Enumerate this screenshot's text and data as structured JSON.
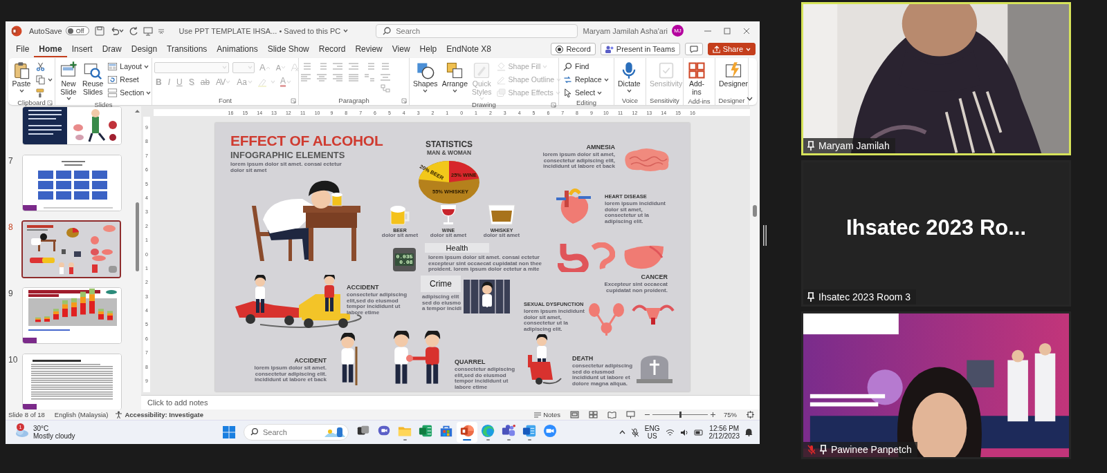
{
  "ppt": {
    "title_bar": {
      "autosave_label": "AutoSave",
      "autosave_on": false,
      "autosave_state": "Off",
      "document": "Use PPT TEMPLATE IHSA...",
      "save_status": "• Saved to this PC",
      "search_placeholder": "Search",
      "user_name": "Maryam Jamilah Asha'ari",
      "user_initials": "MJ"
    },
    "menu_tabs": [
      {
        "label": "File",
        "selected": false
      },
      {
        "label": "Home",
        "selected": true
      },
      {
        "label": "Insert",
        "selected": false
      },
      {
        "label": "Draw",
        "selected": false
      },
      {
        "label": "Design",
        "selected": false
      },
      {
        "label": "Transitions",
        "selected": false
      },
      {
        "label": "Animations",
        "selected": false
      },
      {
        "label": "Slide Show",
        "selected": false
      },
      {
        "label": "Record",
        "selected": false
      },
      {
        "label": "Review",
        "selected": false
      },
      {
        "label": "View",
        "selected": false
      },
      {
        "label": "Help",
        "selected": false
      },
      {
        "label": "EndNote X8",
        "selected": false
      }
    ],
    "header_buttons": [
      {
        "kind": "record",
        "label": "Record"
      },
      {
        "kind": "teams",
        "label": "Present in Teams"
      },
      {
        "kind": "comments"
      },
      {
        "kind": "share",
        "label": "Share"
      }
    ],
    "ribbon": [
      {
        "label": "Clipboard",
        "kind": "buttons",
        "launcher": true,
        "items": [
          {
            "label": "Paste",
            "kind": "large",
            "dropdown": true,
            "disabled": false
          },
          {
            "kind": "tiny",
            "dropdown": false,
            "disabled": false
          },
          {
            "kind": "tiny",
            "dropdown": true,
            "disabled": false
          },
          {
            "kind": "tiny",
            "dropdown": false,
            "disabled": false
          }
        ]
      },
      {
        "label": "Slides",
        "kind": "buttons",
        "launcher": false,
        "items": [
          {
            "label": "New Slide",
            "kind": "large",
            "dropdown": true,
            "disabled": false
          },
          {
            "label": "Reuse Slides",
            "kind": "large",
            "dropdown": false,
            "disabled": false
          },
          {
            "label": "Layout",
            "kind": "small",
            "dropdown": true,
            "disabled": false
          },
          {
            "label": "Reset",
            "kind": "small",
            "dropdown": false,
            "disabled": false
          },
          {
            "label": "Section",
            "kind": "small",
            "dropdown": true,
            "disabled": false
          }
        ]
      },
      {
        "label": "Font",
        "kind": "font",
        "launcher": true,
        "disabled": true,
        "glyphs": [
          {
            "text": "A",
            "kind": "grow"
          },
          {
            "text": "A",
            "kind": "shrink"
          },
          {
            "text": "B",
            "kind": "bold"
          },
          {
            "text": "I",
            "kind": "italic"
          },
          {
            "text": "U",
            "kind": "underline"
          },
          {
            "text": "S",
            "kind": "shadow"
          },
          {
            "text": "ab",
            "kind": "strike"
          },
          {
            "text": "AV",
            "kind": "spacing"
          },
          {
            "text": "Aa",
            "kind": "case"
          },
          {
            "text": "A",
            "kind": "color"
          }
        ]
      },
      {
        "label": "Paragraph",
        "kind": "paragraph",
        "launcher": true,
        "disabled": true
      },
      {
        "label": "Drawing",
        "kind": "buttons",
        "launcher": true,
        "items": [
          {
            "label": "Shapes",
            "kind": "large",
            "dropdown": true,
            "disabled": false
          },
          {
            "label": "Arrange",
            "kind": "large",
            "dropdown": true,
            "disabled": false
          },
          {
            "label": "Quick Styles",
            "kind": "large",
            "dropdown": true,
            "disabled": true
          },
          {
            "label": "Shape Fill",
            "kind": "small",
            "dropdown": true,
            "disabled": true
          },
          {
            "label": "Shape Outline",
            "kind": "small",
            "dropdown": true,
            "disabled": true
          },
          {
            "label": "Shape Effects",
            "kind": "small",
            "dropdown": true,
            "disabled": true
          }
        ]
      },
      {
        "label": "Editing",
        "kind": "buttons",
        "launcher": false,
        "items": [
          {
            "label": "Find",
            "kind": "small",
            "dropdown": false,
            "disabled": false
          },
          {
            "label": "Replace",
            "kind": "small",
            "dropdown": true,
            "disabled": false
          },
          {
            "label": "Select",
            "kind": "small",
            "dropdown": true,
            "disabled": false
          }
        ]
      },
      {
        "label": "Voice",
        "kind": "buttons",
        "launcher": false,
        "items": [
          {
            "label": "Dictate",
            "kind": "large",
            "dropdown": true,
            "disabled": false
          }
        ]
      },
      {
        "label": "Sensitivity",
        "kind": "buttons",
        "launcher": false,
        "items": [
          {
            "label": "Sensitivity",
            "kind": "large",
            "dropdown": false,
            "disabled": true
          }
        ]
      },
      {
        "label": "Add-ins",
        "kind": "buttons",
        "launcher": false,
        "items": [
          {
            "label": "Add-ins",
            "kind": "large",
            "dropdown": false,
            "disabled": false
          }
        ]
      },
      {
        "label": "Designer",
        "kind": "buttons",
        "launcher": false,
        "items": [
          {
            "label": "Designer",
            "kind": "large",
            "dropdown": false,
            "disabled": false
          }
        ]
      }
    ],
    "thumbnails": [
      {
        "kind": "dark-text",
        "selected": false
      },
      {
        "number": "7",
        "kind": "blue-grid",
        "selected": false
      },
      {
        "number": "8",
        "kind": "infographic",
        "selected": true
      },
      {
        "number": "9",
        "kind": "bar-chart",
        "selected": false
      },
      {
        "number": "10",
        "kind": "text-page",
        "selected": false
      }
    ],
    "rulers": {
      "horizontal": [
        "16",
        "15",
        "14",
        "13",
        "12",
        "11",
        "10",
        "9",
        "8",
        "7",
        "6",
        "5",
        "4",
        "3",
        "2",
        "1",
        "0",
        "1",
        "2",
        "3",
        "4",
        "5",
        "6",
        "7",
        "8",
        "9",
        "10",
        "11",
        "12",
        "13",
        "14",
        "15",
        "16"
      ],
      "vertical": [
        "9",
        "8",
        "7",
        "6",
        "5",
        "4",
        "3",
        "2",
        "1",
        "0",
        "1",
        "2",
        "3",
        "4",
        "5",
        "6",
        "7",
        "8",
        "9"
      ]
    },
    "slide": {
      "title": "EFFECT OF ALCOHOL",
      "subtitle": "INFOGRAPHIC ELEMENTS",
      "intro": "lorem ipsum dolor sit amet. consai ectetur\ndolor sit amet",
      "statistics": {
        "title": "STATISTICS",
        "subtitle": "MAN & WOMAN",
        "slice_labels": [
          "20% BEER",
          "25% WINE",
          "55% WHISKEY"
        ]
      },
      "drinks": [
        {
          "label": "BEER",
          "caption": "dolor sit amet"
        },
        {
          "label": "WINE",
          "caption": "dolor sit amet"
        },
        {
          "label": "WHISKEY",
          "caption": "dolor sit amet"
        }
      ],
      "breathalyzer_reading": "0.035\n0.08",
      "blocks": [
        {
          "kind": "plain",
          "heading": "AMNESIA",
          "text": "lorem ipsum dolor sit amet,\nconsectetur adipiscing elit,\nincididunt ut labore et back"
        },
        {
          "kind": "plain",
          "heading": "HEART DISEASE",
          "text": "lorem ipsum incididunt\ndolor sit amet,\nconsectetur ut la\nadipiscing elit."
        },
        {
          "kind": "boxed",
          "heading": "Health",
          "text": "lorem ipsum dolor sit amet. consai ectetur\nexcepteur sint occaecat cupidatat non thee\nproident. lorem ipsum dolor ectetur a mite"
        },
        {
          "kind": "boxed",
          "heading": "Crime",
          "text": "adipiscing elit\nsed do eiusmo\na tempor incidi"
        },
        {
          "kind": "plain",
          "heading": "CANCER",
          "text": "Excepteur sint occaecat\ncupidatat non proident."
        },
        {
          "kind": "plain",
          "heading": "ACCIDENT",
          "text": "consectetur adipiscing\nelit,sed do eiusmod\ntempor incididunt ut\nlabore etime"
        },
        {
          "kind": "plain",
          "heading": "SEXUAL DYSFUNCTION",
          "text": "lorem ipsum incididunt\ndolor sit amet,\nconsectetur ut la\nadipiscing elit."
        },
        {
          "kind": "plain",
          "heading": "ACCIDENT",
          "text": "lorem ipsum dolor sit amet.\nconsectetur adipiscing elit.\nincididunt ut labore et back"
        },
        {
          "kind": "plain",
          "heading": "QUARREL",
          "text": "consectetur adipiscing\nelit,sed do eiusmod\ntempor incididunt ut\nlabore etime"
        },
        {
          "kind": "plain",
          "heading": "DEATH",
          "text": "consectetur adipiscing\nsed do eiusmod\nincididunt ut labore et\ndolore magna aliqua."
        }
      ]
    },
    "notes_placeholder": "Click to add notes",
    "status_bar": {
      "slide_position": "Slide 8 of 18",
      "language": "English (Malaysia)",
      "accessibility": "Accessibility: Investigate",
      "notes": "Notes",
      "zoom_slider": {
        "level": 0.5
      },
      "zoom": "75%"
    }
  },
  "taskbar": {
    "weather": {
      "badge": "1",
      "temperature": "30°C",
      "condition": "Mostly cloudy"
    },
    "search_placeholder": "Search",
    "apps": [
      {
        "kind": "taskview",
        "running": false,
        "selected": false
      },
      {
        "kind": "chat",
        "running": false,
        "selected": false
      },
      {
        "kind": "explorer",
        "running": true,
        "selected": false
      },
      {
        "kind": "excel",
        "running": false,
        "selected": false
      },
      {
        "kind": "store",
        "running": false,
        "selected": false
      },
      {
        "kind": "powerpoint",
        "running": true,
        "selected": true
      },
      {
        "kind": "edge",
        "running": true,
        "selected": false
      },
      {
        "kind": "teams",
        "running": true,
        "selected": false
      },
      {
        "kind": "word",
        "running": true,
        "selected": false
      },
      {
        "kind": "zoom",
        "running": false,
        "selected": false
      }
    ],
    "language": "ENG",
    "region": "US",
    "time": "12:56 PM",
    "date": "2/12/2023"
  },
  "meeting": {
    "participants": [
      {
        "kind": "video",
        "name": "Maryam Jamilah",
        "active_speaker": true,
        "muted": false
      },
      {
        "kind": "name-only",
        "display_name": "Ihsatec 2023 Ro...",
        "name": "Ihsatec 2023 Room 3",
        "active_speaker": false,
        "muted": false
      },
      {
        "kind": "video",
        "name": "Pawinee Panpetch",
        "active_speaker": false,
        "muted": true
      }
    ]
  }
}
